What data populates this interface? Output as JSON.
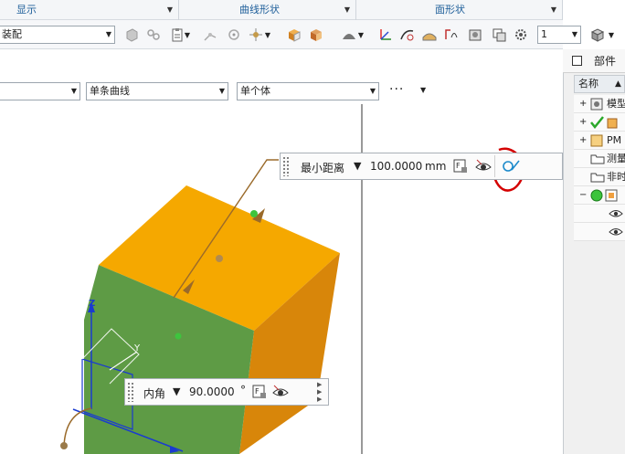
{
  "ribbon": {
    "groups": [
      {
        "label": "显示"
      },
      {
        "label": "曲线形状"
      },
      {
        "label": "面形状"
      }
    ]
  },
  "toolbar": {
    "mode_combo": "装配",
    "count_combo": "1"
  },
  "selection_bar": {
    "filter1": "",
    "curve_rule": "单条曲线",
    "body_rule": "单个体",
    "more_label": "···"
  },
  "measure_distance": {
    "type": "最小距离",
    "value": "100.0000",
    "unit": "mm"
  },
  "angle_dim": {
    "type": "内角",
    "value": "90.0000",
    "unit": "°"
  },
  "axes": {
    "z": "Z",
    "y": "Y"
  },
  "navigator": {
    "title": "部件导",
    "column_name": "名称",
    "rows": [
      {
        "label": "模型",
        "expander": "+"
      },
      {
        "label": "",
        "expander": "+"
      },
      {
        "label": "PM",
        "expander": "+"
      },
      {
        "label": "测量",
        "expander": ""
      },
      {
        "label": "非时",
        "expander": ""
      },
      {
        "label": "",
        "expander": "−"
      },
      {
        "label": "",
        "expander": ""
      },
      {
        "label": "",
        "expander": ""
      }
    ]
  },
  "colors": {
    "cube_top": "#f5a800",
    "cube_front": "#5e9b45",
    "cube_side": "#d8860a",
    "annotation_red": "#d40000",
    "accent_blue": "#1c5d99"
  }
}
